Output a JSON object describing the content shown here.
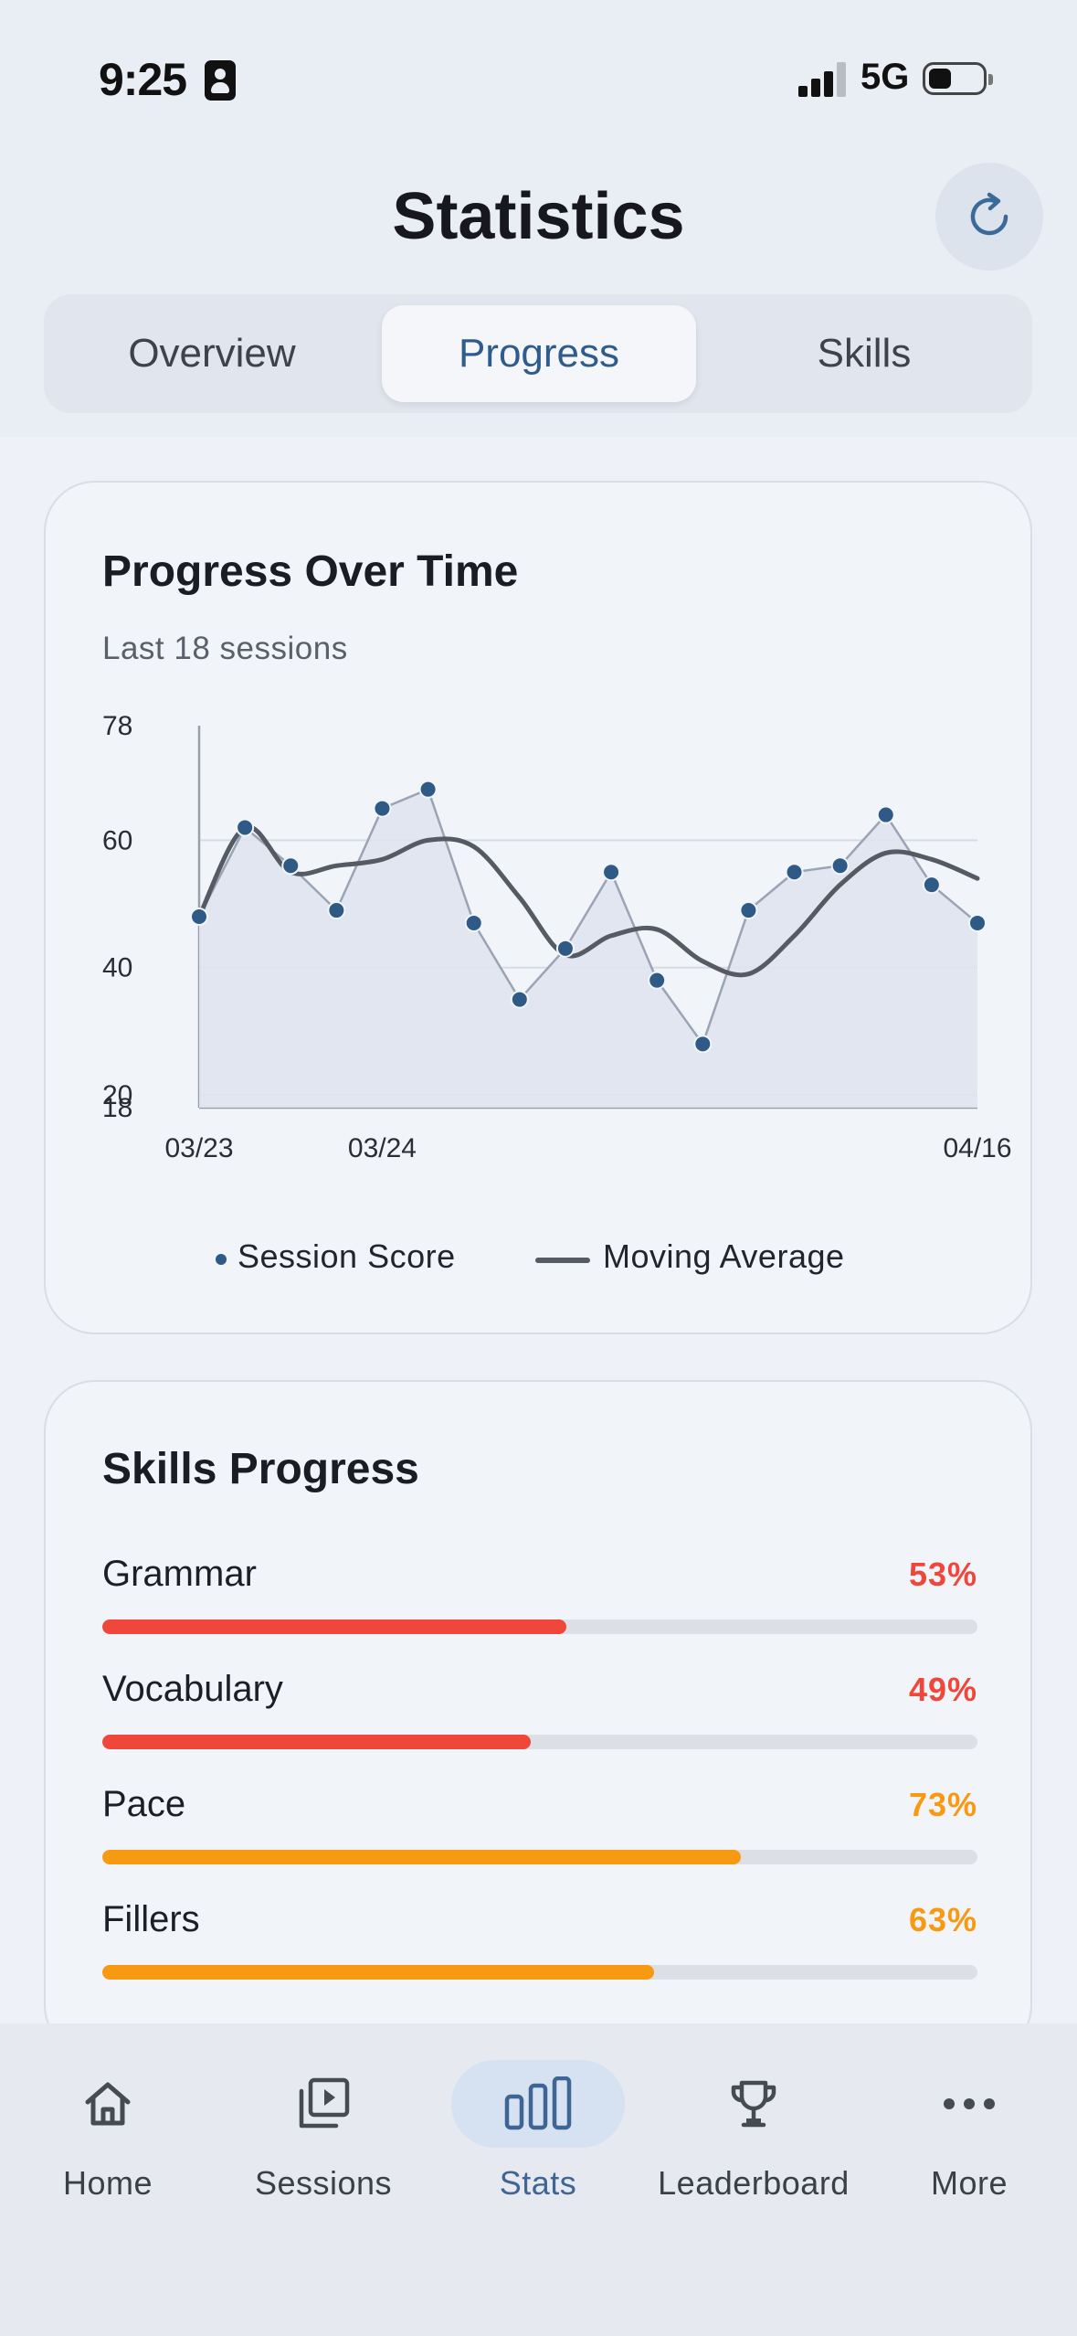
{
  "status_bar": {
    "time": "9:25",
    "network": "5G"
  },
  "header": {
    "title": "Statistics",
    "refresh_icon": "refresh-icon"
  },
  "tabs": [
    {
      "label": "Overview",
      "active": false
    },
    {
      "label": "Progress",
      "active": true
    },
    {
      "label": "Skills",
      "active": false
    }
  ],
  "progress_card": {
    "title": "Progress Over Time",
    "subtitle": "Last 18 sessions",
    "legend": {
      "score_label": "Session Score",
      "average_label": "Moving Average"
    }
  },
  "chart_data": {
    "type": "line",
    "title": "Progress Over Time",
    "subtitle": "Last 18 sessions",
    "x_tick_labels": [
      "03/23",
      "03/24",
      "04/16"
    ],
    "y_ticks": [
      18,
      20,
      40,
      60,
      78
    ],
    "ylim": [
      18,
      78
    ],
    "grid": true,
    "legend_placement": "bottom-center",
    "series": [
      {
        "name": "Session Score",
        "style": "points-with-line-and-area",
        "color": "#2f5a85",
        "values": [
          48,
          62,
          56,
          49,
          65,
          68,
          47,
          35,
          43,
          55,
          38,
          28,
          49,
          55,
          56,
          64,
          53,
          47
        ]
      },
      {
        "name": "Moving Average",
        "style": "smooth-line",
        "color": "#555a63",
        "values": [
          48,
          62,
          55,
          56,
          57,
          60,
          59,
          51,
          42,
          45,
          46,
          41,
          39,
          45,
          53,
          58,
          57,
          54
        ]
      }
    ]
  },
  "skills_card": {
    "title": "Skills Progress",
    "skills": [
      {
        "name": "Grammar",
        "value": 53,
        "label": "53%",
        "color": "#f0473b"
      },
      {
        "name": "Vocabulary",
        "value": 49,
        "label": "49%",
        "color": "#f0473b"
      },
      {
        "name": "Pace",
        "value": 73,
        "label": "73%",
        "color": "#f89912"
      },
      {
        "name": "Fillers",
        "value": 63,
        "label": "63%",
        "color": "#f89912"
      }
    ]
  },
  "bottom_nav": [
    {
      "label": "Home",
      "icon": "home-icon",
      "active": false
    },
    {
      "label": "Sessions",
      "icon": "sessions-icon",
      "active": false
    },
    {
      "label": "Stats",
      "icon": "bar-chart-icon",
      "active": true
    },
    {
      "label": "Leaderboard",
      "icon": "trophy-icon",
      "active": false
    },
    {
      "label": "More",
      "icon": "more-icon",
      "active": false
    }
  ],
  "colors": {
    "accent": "#2f5c8c",
    "background": "#eef1f7",
    "bad": "#f0473b",
    "warning": "#f89912"
  }
}
